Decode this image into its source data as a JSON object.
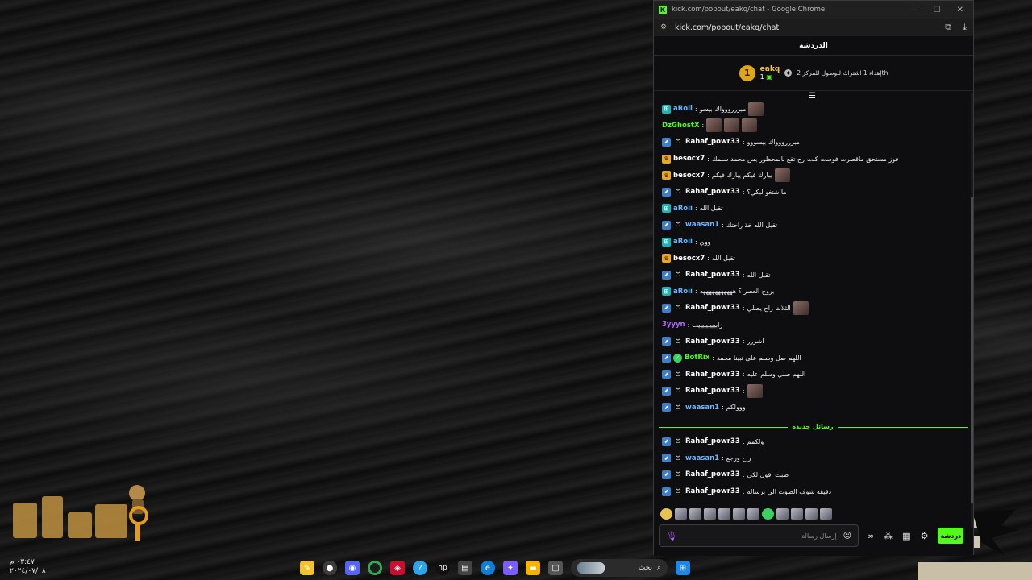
{
  "window": {
    "title": "kick.com/popout/eakq/chat - Google Chrome",
    "url": "kick.com/popout/eakq/chat",
    "favicon_letter": "K"
  },
  "chat": {
    "header": "الدردشة",
    "pinned": {
      "rank": "1",
      "username": "eakq",
      "count": "1",
      "gift_text": "إهداء 1 اشتراك للوصول للمركز 2th"
    },
    "messages": [
      {
        "badges": [
          "og"
        ],
        "username": "aRoii",
        "color": "#6bb6ff",
        "text": "مبرررووواك بيسو",
        "emotes": 1
      },
      {
        "badges": [],
        "username": "DzGhostX",
        "color": "#53fc18",
        "text": "",
        "emotes": 3
      },
      {
        "badges": [
          "sub",
          "hl"
        ],
        "username": "Rahaf_powr33",
        "color": "#ffffff",
        "text": "مبرررووواك بيسووو",
        "emotes": 0
      },
      {
        "badges": [
          "crown"
        ],
        "username": "besocx7",
        "color": "#ffffff",
        "text": "فوز مستحق ماقصرت فوست كنت رح تقع بالمحظور بس محمد سلمك",
        "emotes": 0
      },
      {
        "badges": [
          "crown"
        ],
        "username": "besocx7",
        "color": "#ffffff",
        "text": "يبارك فيكم يبارك فيكم",
        "emotes": 1
      },
      {
        "badges": [
          "sub",
          "hl"
        ],
        "username": "Rahaf_powr33",
        "color": "#ffffff",
        "text": "ما شتغو لبكي؟",
        "emotes": 0
      },
      {
        "badges": [
          "og"
        ],
        "username": "aRoii",
        "color": "#6bb6ff",
        "text": "تقبل الله",
        "emotes": 0
      },
      {
        "badges": [
          "sub",
          "hl"
        ],
        "username": "waasan1",
        "color": "#6bb6ff",
        "text": "تقبل الله خذ راحتك",
        "emotes": 0
      },
      {
        "badges": [
          "og"
        ],
        "username": "aRoii",
        "color": "#6bb6ff",
        "text": "ووي",
        "emotes": 0
      },
      {
        "badges": [
          "crown"
        ],
        "username": "besocx7",
        "color": "#ffffff",
        "text": "تقبل الله",
        "emotes": 0
      },
      {
        "badges": [
          "sub",
          "hl"
        ],
        "username": "Rahaf_powr33",
        "color": "#ffffff",
        "text": "تقبل الله",
        "emotes": 0
      },
      {
        "badges": [
          "og"
        ],
        "username": "aRoii",
        "color": "#6bb6ff",
        "text": "بروح العصر ؟ هههههههههههه",
        "emotes": 0
      },
      {
        "badges": [
          "sub",
          "hl"
        ],
        "username": "Rahaf_powr33",
        "color": "#ffffff",
        "text": "الثلاث راح يصلي",
        "emotes": 1
      },
      {
        "badges": [],
        "username": "3yyyn",
        "color": "#b06bff",
        "text": "زابيييييييييت",
        "emotes": 0
      },
      {
        "badges": [
          "sub",
          "hl"
        ],
        "username": "Rahaf_powr33",
        "color": "#ffffff",
        "text": "اشررر",
        "emotes": 0
      },
      {
        "badges": [
          "sub",
          "verified"
        ],
        "username": "BotRix",
        "color": "#53fc18",
        "text": "اللهم صل وسلم على نبينا محمد",
        "emotes": 0
      },
      {
        "badges": [
          "sub",
          "hl"
        ],
        "username": "Rahaf_powr33",
        "color": "#ffffff",
        "text": "اللهم صلي وسلم عليه",
        "emotes": 0
      },
      {
        "badges": [
          "sub",
          "hl"
        ],
        "username": "Rahaf_powr33",
        "color": "#ffffff",
        "text": "",
        "emotes": 1
      },
      {
        "badges": [
          "sub",
          "hl"
        ],
        "username": "waasan1",
        "color": "#6bb6ff",
        "text": "ووولكم",
        "emotes": 0
      }
    ],
    "new_messages_label": "رسائل جديدة",
    "new_messages": [
      {
        "badges": [
          "sub",
          "hl"
        ],
        "username": "Rahaf_powr33",
        "color": "#ffffff",
        "text": "ولكمم",
        "emotes": 0
      },
      {
        "badges": [
          "sub",
          "hl"
        ],
        "username": "waasan1",
        "color": "#6bb6ff",
        "text": "راح ورجع",
        "emotes": 0
      },
      {
        "badges": [
          "sub",
          "hl"
        ],
        "username": "Rahaf_powr33",
        "color": "#ffffff",
        "text": "صبت اقول لكي",
        "emotes": 0
      },
      {
        "badges": [
          "sub",
          "hl"
        ],
        "username": "Rahaf_powr33",
        "color": "#ffffff",
        "text": "دقيقه شوف الصوت الي برساله",
        "emotes": 0
      }
    ],
    "input_placeholder": "إرسال رسالة",
    "send_label": "دردشة"
  },
  "taskbar": {
    "search_label": "بحث"
  },
  "desktop": {
    "time": "٠٣:٤٧ م",
    "date": "٢٠٢٤/٠٧/٠٨"
  },
  "colors": {
    "kick_green": "#53fc18",
    "background": "#0e0e10"
  }
}
